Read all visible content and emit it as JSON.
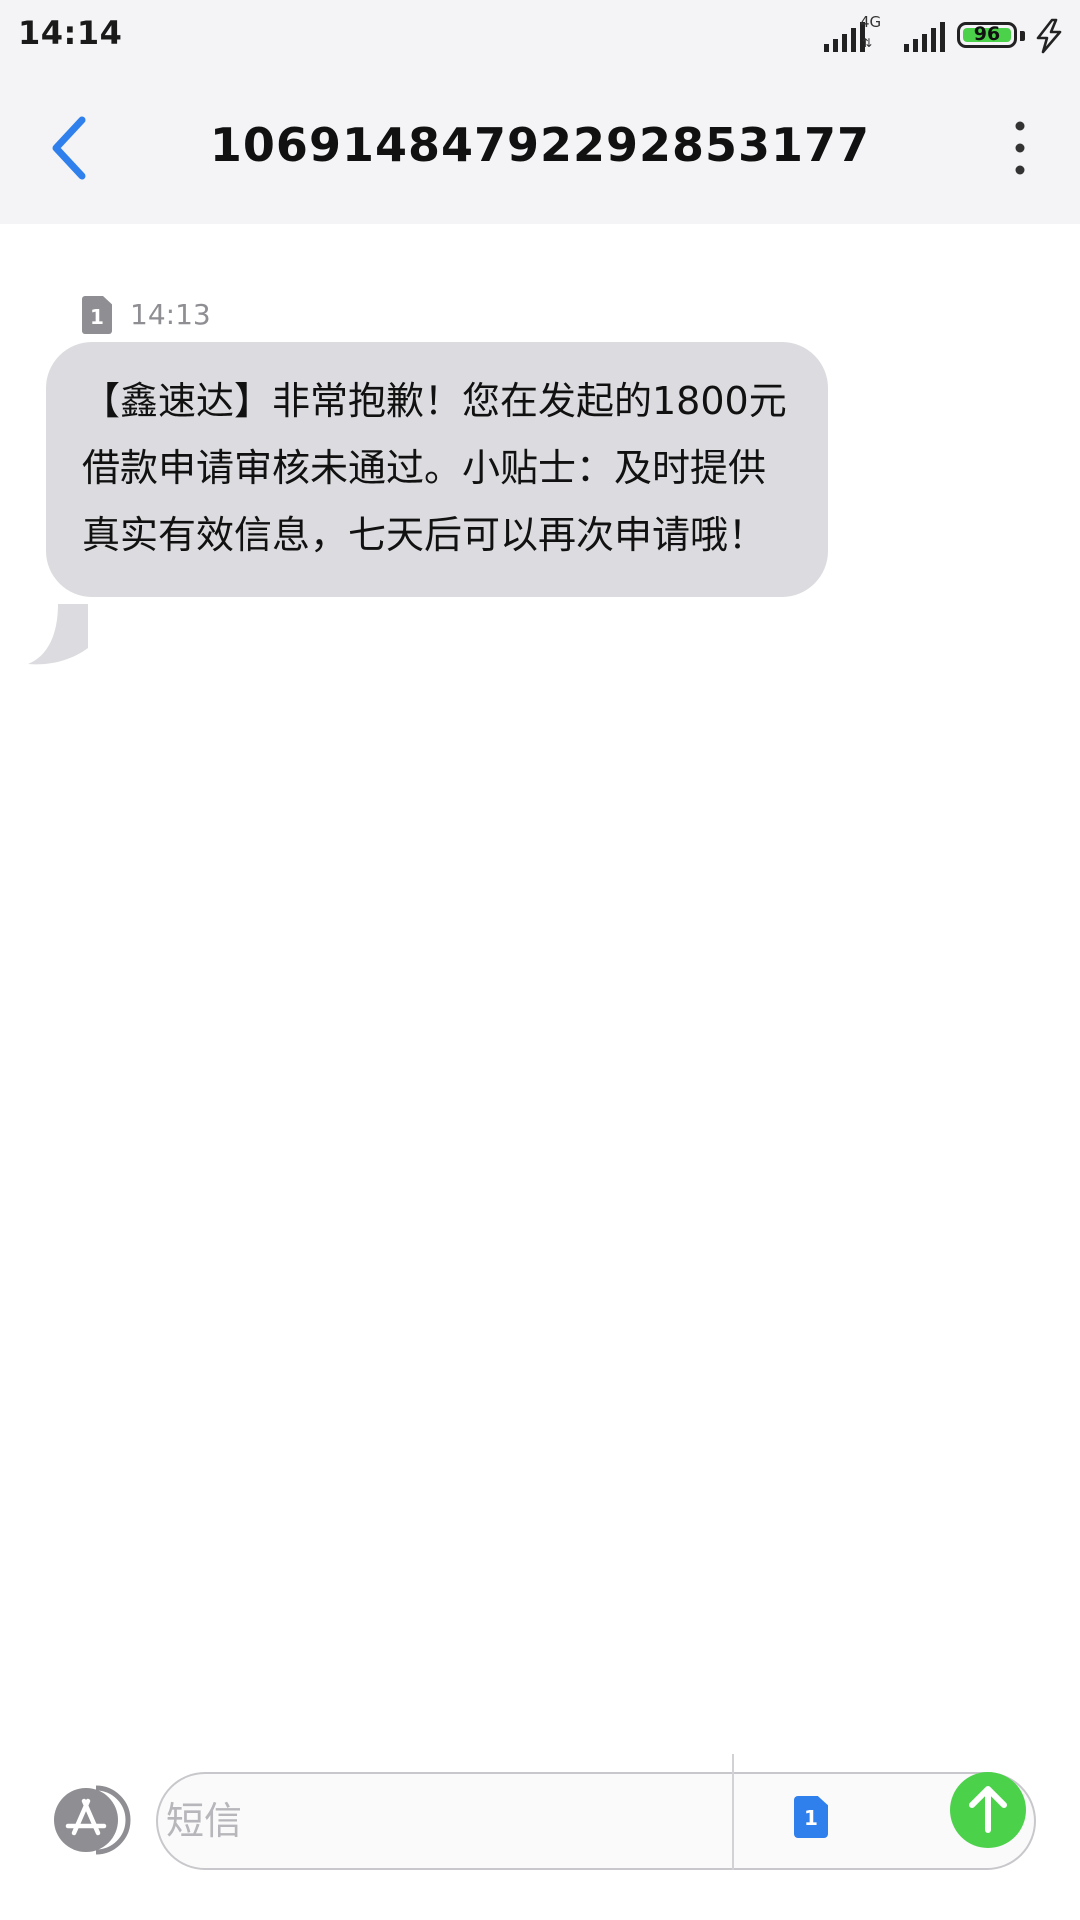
{
  "status_bar": {
    "time": "14:14",
    "network_type": "4G",
    "battery_level": "96",
    "icons": [
      "signal-icon",
      "signal-4g-icon",
      "battery-icon",
      "charging-icon"
    ]
  },
  "header": {
    "title": "10691484792292853177",
    "back_icon": "chevron-left-icon",
    "more_icon": "more-vertical-icon"
  },
  "conversation": {
    "messages": [
      {
        "sim_slot": "1",
        "time": "14:13",
        "text": "【鑫速达】非常抱歉！您在发起的1800元借款申请审核未通过。小贴士：及时提供真实有效信息，七天后可以再次申请哦！"
      }
    ]
  },
  "compose": {
    "placeholder": "短信",
    "sim_slot": "1",
    "apps_icon": "app-store-icon",
    "send_icon": "arrow-up-icon"
  },
  "colors": {
    "accent_blue": "#2f80ed",
    "send_green": "#4cd24a",
    "bubble_gray": "#dcdce0",
    "header_bg": "#f4f4f6"
  }
}
